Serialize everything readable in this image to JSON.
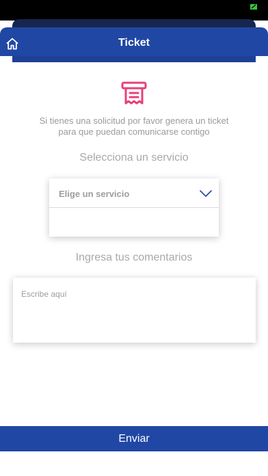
{
  "header": {
    "title": "Ticket",
    "home_icon": "home-icon"
  },
  "intro": {
    "line1": "Si tienes una solicitud por favor genera un ticket",
    "line2": "para que puedan comunicarse contigo"
  },
  "service_section": {
    "label": "Selecciona un servicio",
    "select_value": "Elige un servicio",
    "chevron_icon": "chevron-down-icon"
  },
  "comments_section": {
    "label": "Ingresa tus comentarios",
    "placeholder": "Escribe aquí"
  },
  "submit": {
    "label": "Enviar"
  },
  "colors": {
    "primary": "#2147a5",
    "icon_accent": "#e8407a",
    "muted_text": "#9a9a9a",
    "battery": "#3bc43b"
  }
}
